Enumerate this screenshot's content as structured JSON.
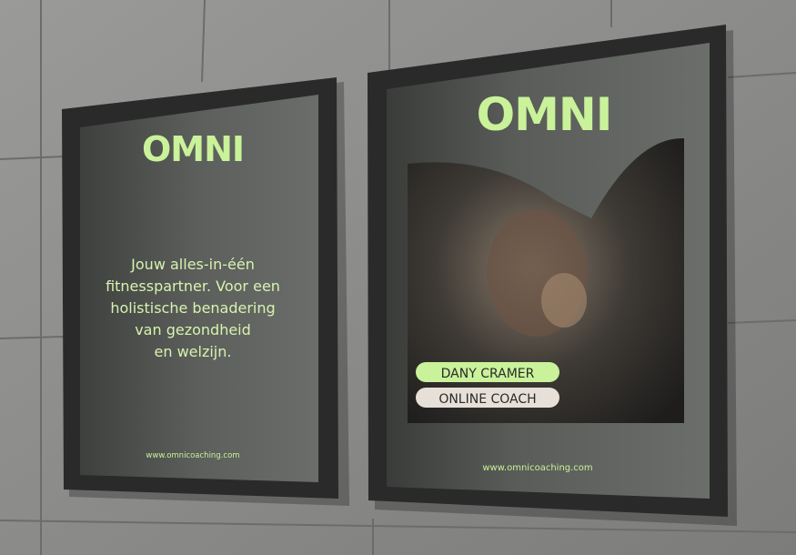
{
  "left_poster": {
    "logo": "OMNI",
    "tagline_lines": [
      "Jouw alles-in-één",
      "fitnesspartner. Voor een",
      "holistische benadering",
      "van gezondheid",
      "en welzijn."
    ],
    "url": "www.omnicoaching.com"
  },
  "right_poster": {
    "logo": "OMNI",
    "name_label": "DANY CRAMER",
    "role_label": "ONLINE COACH",
    "url": "www.omnicoaching.com"
  },
  "colors": {
    "accent": "#c9f29a",
    "poster_bg": "#5f625e",
    "wall": "#8b8b89",
    "frame": "#2b2b2b",
    "role_pill": "#e6e0d8"
  }
}
